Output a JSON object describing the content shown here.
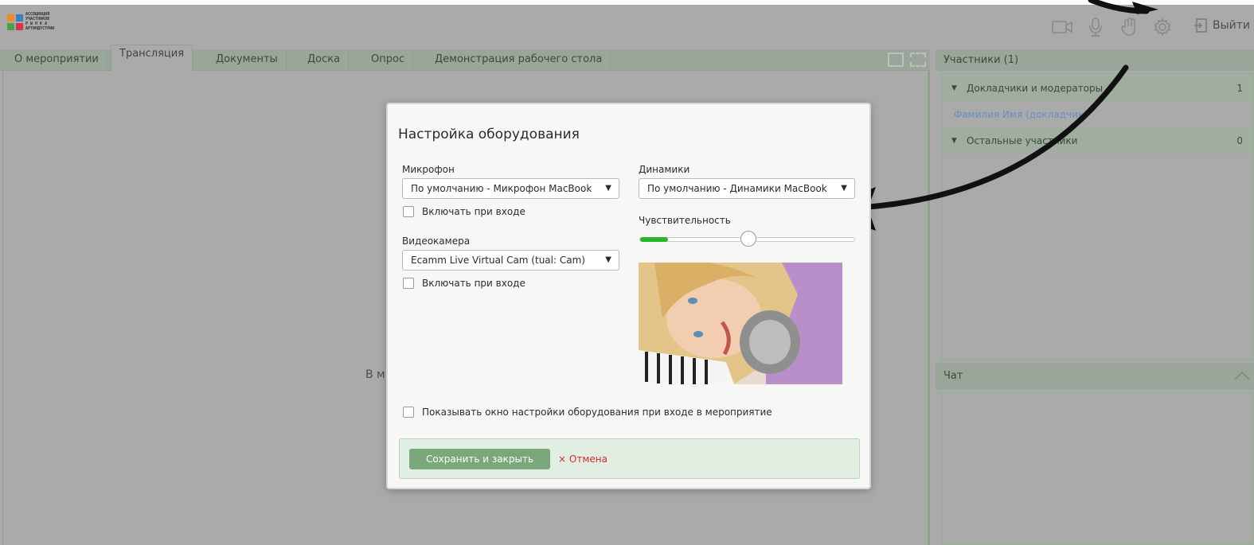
{
  "header": {
    "logo_lines": [
      "АССОЦИАЦИЯ",
      "УЧАСТНИКОВ",
      "Р Ы Н К А",
      "АРТИНДУСТРИИ"
    ],
    "icons": [
      "camera-icon",
      "microphone-icon",
      "hand-icon",
      "gear-icon"
    ],
    "logout_label": "Выйти"
  },
  "tabs": [
    "О мероприятии",
    "Трансляция",
    "Документы",
    "Доска",
    "Опрос",
    "Демонстрация рабочего стола"
  ],
  "active_tab": "Трансляция",
  "main": {
    "message": "В м"
  },
  "participants": {
    "title": "Участники (1)",
    "groups": [
      {
        "label": "Докладчики и модераторы",
        "count": "1"
      },
      {
        "label": "Остальные участники",
        "count": "0"
      }
    ],
    "person": "Фамилия Имя (докладчик)"
  },
  "chat": {
    "title": "Чат"
  },
  "modal": {
    "title": "Настройка оборудования",
    "microphone_label": "Микрофон",
    "microphone_value": "По умолчанию - Микрофон MacBook",
    "mic_on_enter": "Включать при входе",
    "camera_label": "Видеокамера",
    "camera_value": "Ecamm Live Virtual Cam (tual: Cam)",
    "camera_on_enter": "Включать при входе",
    "speakers_label": "Динамики",
    "speakers_value": "По умолчанию - Динамики MacBook",
    "sensitivity_label": "Чувствительность",
    "sensitivity_value": 0.5,
    "audio_level": 0.13,
    "show_on_enter": "Показывать окно настройки оборудования при входе в мероприятие",
    "save_label": "Сохранить и закрыть",
    "cancel_label": "Отмена",
    "cancel_icon": "×"
  },
  "colors": {
    "accent": "#7aa87a",
    "level": "#2bb52b",
    "cancel": "#d12c2c",
    "link": "#6a8dc2"
  }
}
